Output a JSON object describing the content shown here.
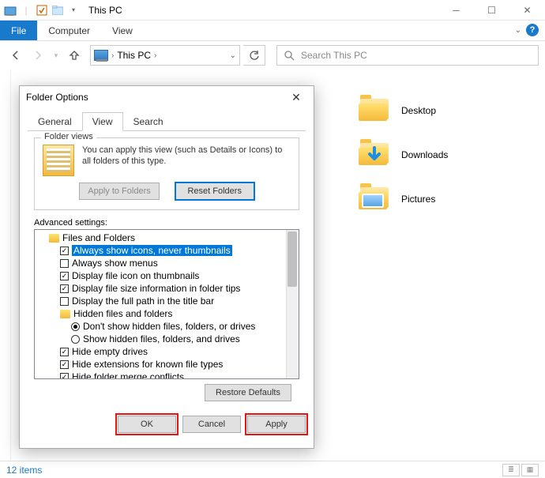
{
  "window": {
    "title": "This PC",
    "min_tip": "Minimize",
    "max_tip": "Maximize",
    "close_tip": "Close"
  },
  "ribbon": {
    "file": "File",
    "computer": "Computer",
    "view": "View"
  },
  "nav": {
    "breadcrumb_text": "This PC",
    "breadcrumb_sep": "›",
    "search_placeholder": "Search This PC"
  },
  "folders": [
    {
      "label": "Desktop"
    },
    {
      "label": "Downloads"
    },
    {
      "label": "Pictures"
    }
  ],
  "status": {
    "count": "12 items"
  },
  "dialog": {
    "title": "Folder Options",
    "tabs": {
      "general": "General",
      "view": "View",
      "search": "Search"
    },
    "folder_views": {
      "legend": "Folder views",
      "text": "You can apply this view (such as Details or Icons) to all folders of this type.",
      "apply_btn": "Apply to Folders",
      "reset_btn": "Reset Folders"
    },
    "adv_label": "Advanced settings:",
    "tree": {
      "root": "Files and Folders",
      "n1": "Always show icons, never thumbnails",
      "n2": "Always show menus",
      "n3": "Display file icon on thumbnails",
      "n4": "Display file size information in folder tips",
      "n5": "Display the full path in the title bar",
      "n6": "Hidden files and folders",
      "n6a": "Don't show hidden files, folders, or drives",
      "n6b": "Show hidden files, folders, and drives",
      "n7": "Hide empty drives",
      "n8": "Hide extensions for known file types",
      "n9": "Hide folder merge conflicts"
    },
    "restore": "Restore Defaults",
    "ok": "OK",
    "cancel": "Cancel",
    "apply": "Apply"
  }
}
